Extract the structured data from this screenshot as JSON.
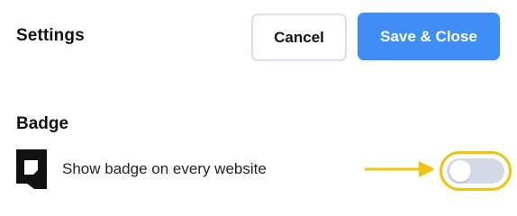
{
  "header": {
    "title": "Settings",
    "cancel_label": "Cancel",
    "save_label": "Save & Close"
  },
  "badge_section": {
    "title": "Badge",
    "icon": "badge-icon",
    "setting_label": "Show badge on every website",
    "toggle_enabled": false
  },
  "colors": {
    "primary": "#3f8ef5",
    "highlight": "#f2c20d",
    "toggle_track_off": "#d5dbe6"
  }
}
